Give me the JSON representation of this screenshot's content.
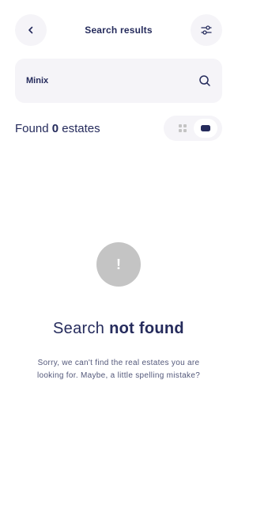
{
  "header": {
    "title": "Search results",
    "back_icon": "chevron-left-icon",
    "filter_icon": "sliders-icon"
  },
  "search": {
    "value": "Minix",
    "icon": "search-icon"
  },
  "results": {
    "prefix": "Found",
    "count": "0",
    "suffix": "estates",
    "view_modes": [
      "grid-view-icon",
      "list-view-icon"
    ],
    "active_view": "list"
  },
  "empty_state": {
    "icon_symbol": "!",
    "title_regular": "Search",
    "title_bold": "not found",
    "description": "Sorry, we can't find the real estates you are looking for. Maybe, a little spelling mistake?"
  },
  "colors": {
    "primary": "#252B5C",
    "surface": "#F5F4F8",
    "muted": "#C4C4C4",
    "text_secondary": "#53587A"
  }
}
